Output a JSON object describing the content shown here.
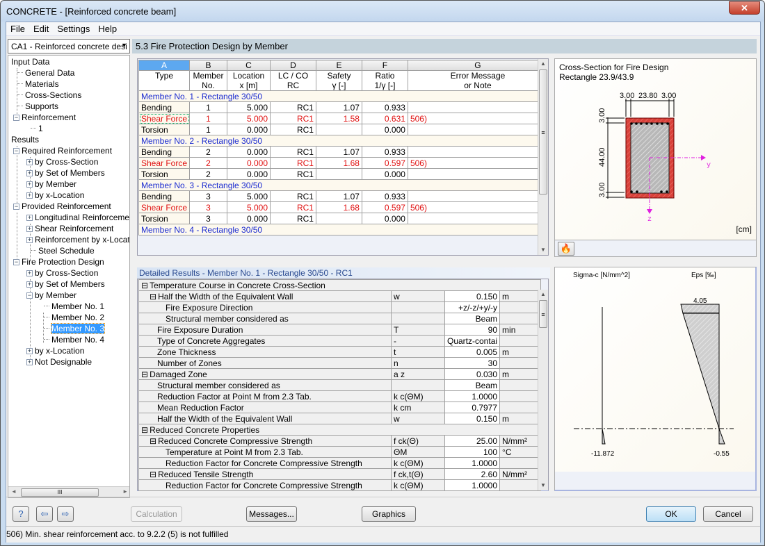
{
  "window": {
    "title": "CONCRETE - [Reinforced concrete beam]",
    "close_glyph": "✕"
  },
  "menu": [
    "File",
    "Edit",
    "Settings",
    "Help"
  ],
  "case_select": {
    "value": "CA1 - Reinforced concrete desi",
    "arrow": "▼"
  },
  "nav": {
    "input_data": "Input Data",
    "general_data": "General Data",
    "materials": "Materials",
    "cross_sections": "Cross-Sections",
    "supports": "Supports",
    "reinforcement": "Reinforcement",
    "reinforcement_1": "1",
    "results": "Results",
    "required_reinforcement": "Required Reinforcement",
    "rr_by_cross_section": "by Cross-Section",
    "rr_by_set_of_members": "by Set of Members",
    "rr_by_member": "by Member",
    "rr_by_x_location": "by x-Location",
    "provided_reinforcement": "Provided Reinforcement",
    "longitudinal_reinforcement": "Longitudinal Reinforcement",
    "shear_reinforcement": "Shear Reinforcement",
    "reinforcement_by_x_location": "Reinforcement by x-Locatio",
    "steel_schedule": "Steel Schedule",
    "fire_protection_design": "Fire Protection Design",
    "fp_by_cross_section": "by Cross-Section",
    "fp_by_set_of_members": "by Set of Members",
    "fp_by_member": "by Member",
    "member_1": "Member No. 1",
    "member_2": "Member No. 2",
    "member_3": "Member No. 3",
    "member_4": "Member No. 4",
    "fp_by_x_location": "by x-Location",
    "not_designable": "Not Designable",
    "selected": "Member No. 3"
  },
  "section_header": "5.3 Fire Protection Design by Member",
  "results_table": {
    "column_letters": [
      "A",
      "B",
      "C",
      "D",
      "E",
      "F",
      "G"
    ],
    "headers_line1": [
      "Type",
      "Member",
      "Location",
      "LC / CO",
      "Safety",
      "Ratio",
      "Error Message"
    ],
    "headers_line2": [
      "",
      "No.",
      "x [m]",
      "RC",
      "γ [-]",
      "1/γ [-]",
      "or Note"
    ],
    "groups": [
      {
        "title": "Member No. 1 - Rectangle 30/50",
        "rows": [
          {
            "type": "Bending",
            "member": "1",
            "x": "5.000",
            "lc": "RC1",
            "safety": "1.07",
            "ratio": "0.933",
            "note": "",
            "error": false
          },
          {
            "type": "Shear Force",
            "member": "1",
            "x": "5.000",
            "lc": "RC1",
            "safety": "1.58",
            "ratio": "0.631",
            "note": "506)",
            "error": true
          },
          {
            "type": "Torsion",
            "member": "1",
            "x": "0.000",
            "lc": "RC1",
            "safety": "",
            "ratio": "0.000",
            "note": "",
            "error": false
          }
        ]
      },
      {
        "title": "Member No. 2 - Rectangle 30/50",
        "rows": [
          {
            "type": "Bending",
            "member": "2",
            "x": "0.000",
            "lc": "RC1",
            "safety": "1.07",
            "ratio": "0.933",
            "note": "",
            "error": false
          },
          {
            "type": "Shear Force",
            "member": "2",
            "x": "0.000",
            "lc": "RC1",
            "safety": "1.68",
            "ratio": "0.597",
            "note": "506)",
            "error": true
          },
          {
            "type": "Torsion",
            "member": "2",
            "x": "0.000",
            "lc": "RC1",
            "safety": "",
            "ratio": "0.000",
            "note": "",
            "error": false
          }
        ]
      },
      {
        "title": "Member No. 3 - Rectangle 30/50",
        "rows": [
          {
            "type": "Bending",
            "member": "3",
            "x": "5.000",
            "lc": "RC1",
            "safety": "1.07",
            "ratio": "0.933",
            "note": "",
            "error": false
          },
          {
            "type": "Shear Force",
            "member": "3",
            "x": "5.000",
            "lc": "RC1",
            "safety": "1.68",
            "ratio": "0.597",
            "note": "506)",
            "error": true
          },
          {
            "type": "Torsion",
            "member": "3",
            "x": "0.000",
            "lc": "RC1",
            "safety": "",
            "ratio": "0.000",
            "note": "",
            "error": false
          }
        ]
      },
      {
        "title": "Member No. 4 - Rectangle 30/50",
        "rows": []
      }
    ]
  },
  "cross_section": {
    "title": "Cross-Section for Fire Design",
    "subtitle": "Rectangle 23.9/43.9",
    "dim_top": [
      "3.00",
      "23.80",
      "3.00"
    ],
    "dim_left": [
      "3.00",
      "44.00",
      "3.00"
    ],
    "axis_y": "y",
    "axis_z": "z",
    "unit": "[cm]",
    "colors": {
      "fire_zone": "#d9413a",
      "concrete": "#b8b8b8",
      "axes": "#e020e0"
    }
  },
  "detail_title": "Detailed Results  -  Member No. 1  -  Rectangle 30/50  -  RC1",
  "detail_rows": [
    {
      "level": 0,
      "toggle": "⊟",
      "label": "Temperature Course in Concrete Cross-Section",
      "sym": "",
      "val": "",
      "unit": "",
      "section": true
    },
    {
      "level": 1,
      "toggle": "⊟",
      "label": "Half the Width of the Equivalent Wall",
      "sym": "w",
      "val": "0.150",
      "unit": "m"
    },
    {
      "level": 2,
      "toggle": "",
      "label": "Fire Exposure Direction",
      "sym": "",
      "val": "+z/-z/+y/-y",
      "unit": ""
    },
    {
      "level": 2,
      "toggle": "",
      "label": "Structural member considered as",
      "sym": "",
      "val": "Beam",
      "unit": ""
    },
    {
      "level": 1,
      "toggle": "",
      "label": "Fire Exposure Duration",
      "sym": "T",
      "val": "90",
      "unit": "min"
    },
    {
      "level": 1,
      "toggle": "",
      "label": "Type of Concrete Aggregates",
      "sym": "-",
      "val": "Quartz-contai",
      "unit": ""
    },
    {
      "level": 1,
      "toggle": "",
      "label": "Zone Thickness",
      "sym": "t",
      "val": "0.005",
      "unit": "m"
    },
    {
      "level": 1,
      "toggle": "",
      "label": "Number of Zones",
      "sym": "n",
      "val": "30",
      "unit": ""
    },
    {
      "level": 0,
      "toggle": "⊟",
      "label": "Damaged Zone",
      "sym": "a z",
      "val": "0.030",
      "unit": "m"
    },
    {
      "level": 1,
      "toggle": "",
      "label": "Structural member considered as",
      "sym": "",
      "val": "Beam",
      "unit": ""
    },
    {
      "level": 1,
      "toggle": "",
      "label": "Reduction Factor at Point M from 2.3 Tab.",
      "sym": "k c(ΘM)",
      "val": "1.0000",
      "unit": ""
    },
    {
      "level": 1,
      "toggle": "",
      "label": "Mean Reduction Factor",
      "sym": "k cm",
      "val": "0.7977",
      "unit": ""
    },
    {
      "level": 1,
      "toggle": "",
      "label": "Half the Width of the Equivalent Wall",
      "sym": "w",
      "val": "0.150",
      "unit": "m"
    },
    {
      "level": 0,
      "toggle": "⊟",
      "label": "Reduced Concrete Properties",
      "sym": "",
      "val": "",
      "unit": "",
      "section": true
    },
    {
      "level": 1,
      "toggle": "⊟",
      "label": "Reduced Concrete Compressive Strength",
      "sym": "f ck(Θ)",
      "val": "25.00",
      "unit": "N/mm²"
    },
    {
      "level": 2,
      "toggle": "",
      "label": "Temperature at Point M from 2.3 Tab.",
      "sym": "ΘM",
      "val": "100",
      "unit": "°C"
    },
    {
      "level": 2,
      "toggle": "",
      "label": "Reduction Factor for Concrete Compressive Strength",
      "sym": "k c(ΘM)",
      "val": "1.0000",
      "unit": ""
    },
    {
      "level": 1,
      "toggle": "⊟",
      "label": "Reduced Tensile Strength",
      "sym": "f ck,t(Θ)",
      "val": "2.60",
      "unit": "N/mm²"
    },
    {
      "level": 2,
      "toggle": "",
      "label": "Reduction Factor for Concrete Compressive Strength",
      "sym": "k c(ΘM)",
      "val": "1.0000",
      "unit": ""
    }
  ],
  "stress_diagram": {
    "sigma_label": "Sigma-c [N/mm^2]",
    "eps_label": "Eps [‰]",
    "eps_top": "4.05",
    "sigma_bottom": "-11.872",
    "eps_bottom": "-0.55"
  },
  "buttons": {
    "help": "?",
    "prev": "⇦",
    "next": "⇨",
    "calculation": "Calculation",
    "messages": "Messages...",
    "graphics": "Graphics",
    "ok": "OK",
    "cancel": "Cancel"
  },
  "status": "506) Min. shear reinforcement acc. to 9.2.2 (5)  is not fulfilled",
  "scroll": {
    "up": "▲",
    "down": "▼",
    "left": "◄",
    "right": "►",
    "grip": "≡",
    "hgrip": "III"
  }
}
